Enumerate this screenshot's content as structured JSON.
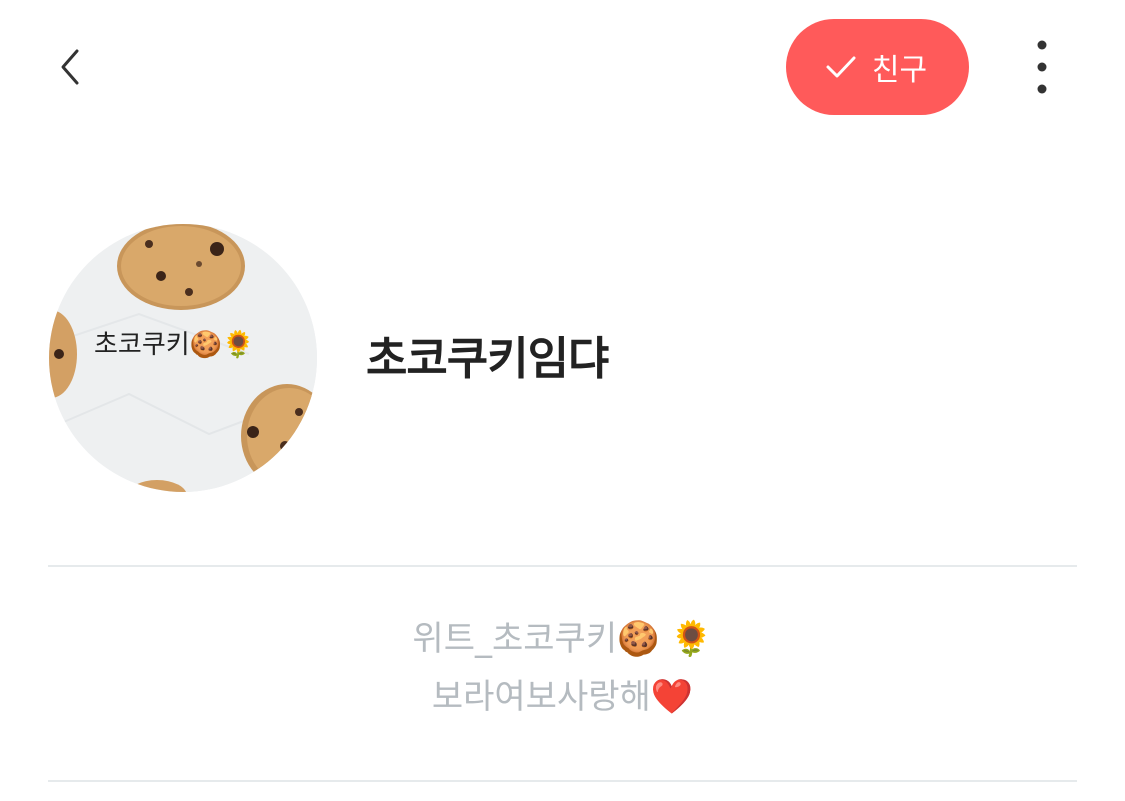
{
  "header": {
    "back_icon": "chevron-left-icon",
    "friend_button": {
      "icon": "check-icon",
      "label": "친구",
      "color": "#FF5A5A"
    },
    "more_icon": "vertical-ellipsis-icon"
  },
  "profile": {
    "avatar_caption": "초코쿠키🍪🌻",
    "name": "초코쿠키임댜"
  },
  "status_message": {
    "line1": "위트_초코쿠키🍪 🌻",
    "line2": "보라여보사랑해❤️"
  },
  "colors": {
    "accent": "#FF5A5A",
    "status_text": "#b5bbc0",
    "divider": "#e6eaec",
    "name_text": "#222222"
  }
}
